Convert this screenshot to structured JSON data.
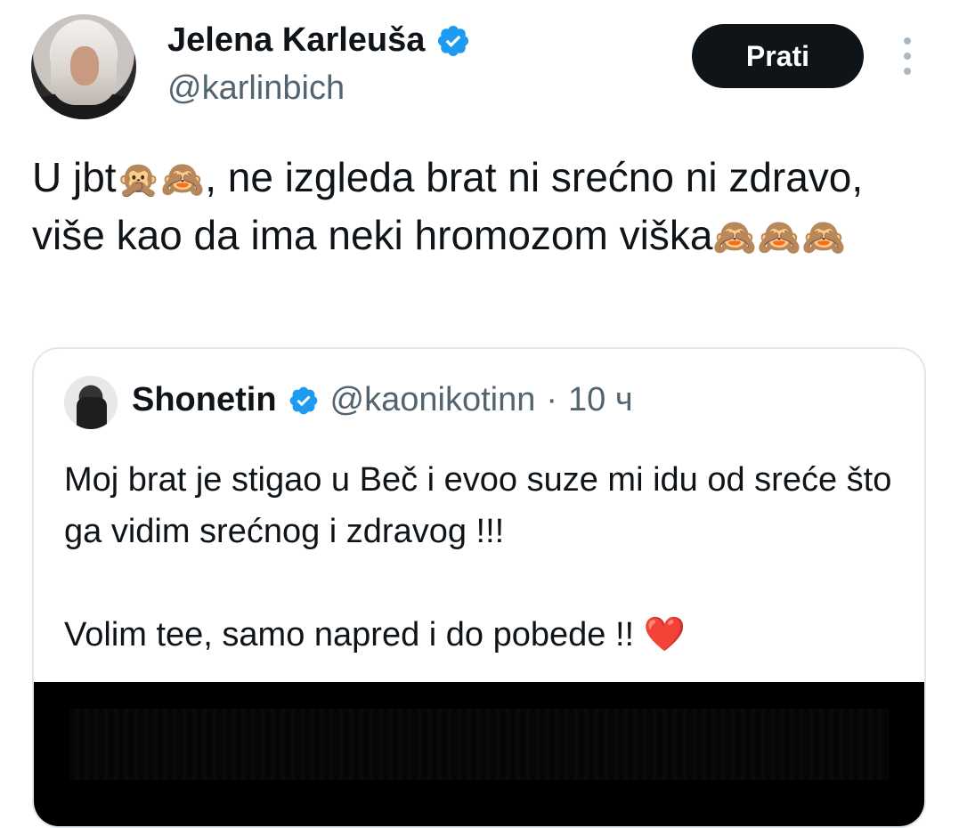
{
  "author": {
    "display_name": "Jelena Karleuša",
    "handle": "@karlinbich",
    "verified": true
  },
  "actions": {
    "follow_label": "Prati",
    "more_icon": "more-vertical-icon"
  },
  "tweet": {
    "text_before_emoji": "U jbt",
    "emoji_1": "🙊🙈",
    "text_middle": ", ne izgleda brat ni srećno ni zdravo, više kao da ima neki hromozom viška",
    "emoji_2": "🙈🙈🙈"
  },
  "quoted_tweet": {
    "display_name": "Shonetin",
    "handle": "@kaonikotinn",
    "separator": "·",
    "time": "10 ч",
    "verified": true,
    "text": "Moj brat je stigao u Beč i evoo suze mi idu od sreće što ga vidim srećnog i zdravog !!!\n\nVolim tee, samo napred i do pobede !! ",
    "heart": "❤️"
  },
  "colors": {
    "verified_blue": "#1d9bf0",
    "text_primary": "#0f1419",
    "text_secondary": "#536471",
    "follow_bg": "#0f1419"
  }
}
